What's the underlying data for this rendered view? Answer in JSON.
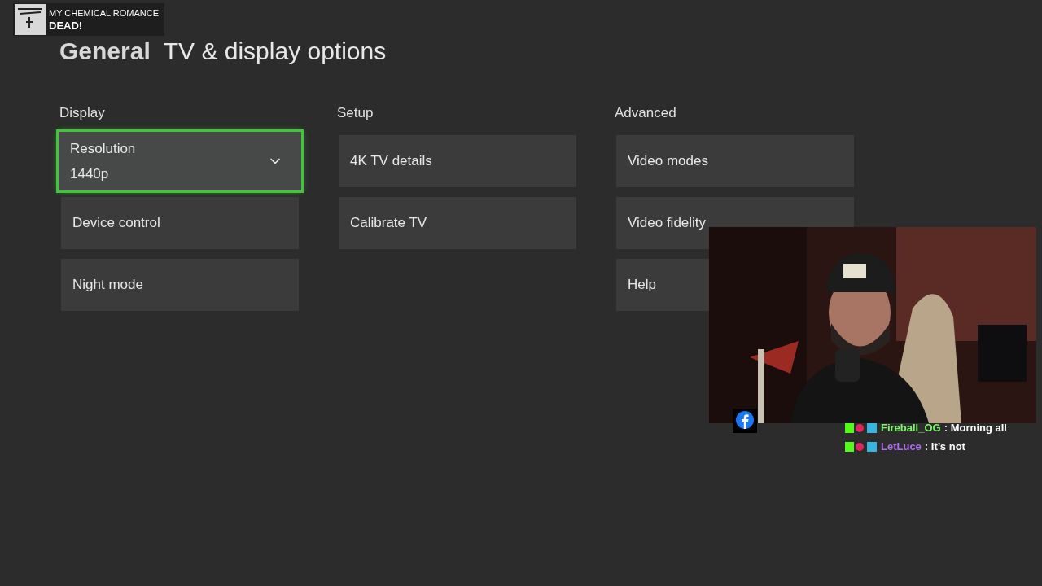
{
  "header": {
    "section": "General",
    "title": "TV & display options"
  },
  "columns": [
    {
      "heading": "Display",
      "items": [
        {
          "kind": "dropdown",
          "label": "Resolution",
          "value": "1440p",
          "selected": true
        },
        {
          "kind": "button",
          "label": "Device control",
          "selected": false
        },
        {
          "kind": "button",
          "label": "Night mode",
          "selected": false
        }
      ]
    },
    {
      "heading": "Setup",
      "items": [
        {
          "kind": "button",
          "label": "4K TV details",
          "selected": false
        },
        {
          "kind": "button",
          "label": "Calibrate TV",
          "selected": false
        }
      ]
    },
    {
      "heading": "Advanced",
      "items": [
        {
          "kind": "button",
          "label": "Video modes",
          "selected": false
        },
        {
          "kind": "button",
          "label": "Video fidelity",
          "selected": false
        },
        {
          "kind": "button",
          "label": "Help",
          "selected": false
        }
      ]
    }
  ],
  "now_playing": {
    "artist": "MY CHEMICAL ROMANCE",
    "track": "DEAD!"
  },
  "chat": [
    {
      "user": "Fireball_OG",
      "color": "#7cf56a",
      "message": ": Morning all"
    },
    {
      "user": "LetLuce",
      "color": "#b06cf0",
      "message": ": It’s not"
    }
  ]
}
